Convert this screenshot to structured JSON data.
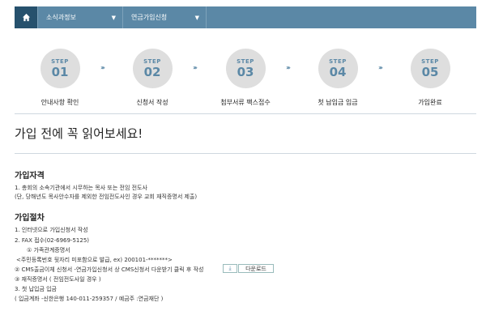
{
  "nav": {
    "home_icon": "home-icon",
    "items": [
      {
        "label": "소식과정보"
      },
      {
        "label": "연금가입신청"
      }
    ]
  },
  "steps": [
    {
      "word": "STEP",
      "num": "01",
      "label": "안내사항 확인"
    },
    {
      "word": "STEP",
      "num": "02",
      "label": "신청서 작성"
    },
    {
      "word": "STEP",
      "num": "03",
      "label": "첨부서류 팩스접수"
    },
    {
      "word": "STEP",
      "num": "04",
      "label": "첫 납입금 입금"
    },
    {
      "word": "STEP",
      "num": "05",
      "label": "가입완료"
    }
  ],
  "step_arrow": "›››",
  "page_title": "가입 전에 꼭 읽어보세요!",
  "qualification": {
    "title": "가입자격",
    "lines": [
      "1. 총회의 소속기관에서 시무하는 목사 또는 전임 전도사",
      "(단, 당해년도 목사안수자를 제외한 전임전도사인 경우 교회 재직증명서 제출)"
    ]
  },
  "procedure": {
    "title": "가입절차",
    "lines": [
      "1. 인터넷으로 가입신청서 작성",
      "2. FAX 접수(02-6969-5125)",
      "① 가족관계증명서",
      "<주민등록번호 뒷자리 미포함으로 발급, ex) 200101-*******>",
      "② CMS출금이체 신청서 -연금가입신청서 상 CMS신청서 다운받기 클릭 후 작성",
      "③ 재직증명서 ( 전임전도사일 경우 )",
      "3. 첫 납입금 입금",
      "( 입금계좌 -신한은행 140-011-259357 / 예금주 :연금재단 )"
    ]
  },
  "download": {
    "icon": "download-icon",
    "icon_glyph": "⤓",
    "label": "다운로드"
  },
  "colors": {
    "nav_bg": "#5b88a6",
    "home_bg": "#26516d",
    "step_circle": "#dedede",
    "accent": "#5b88a6"
  }
}
